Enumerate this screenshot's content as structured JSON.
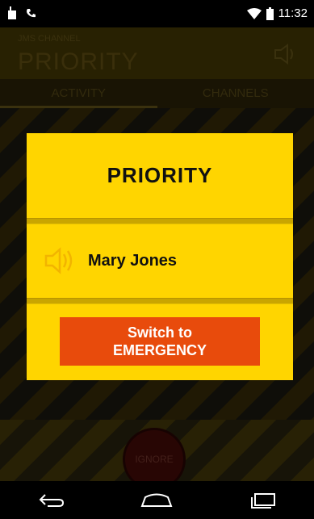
{
  "status_bar": {
    "time": "11:32",
    "icons": [
      "notification-icon",
      "voicemail-icon",
      "wifi-icon",
      "battery-icon"
    ]
  },
  "app": {
    "subtitle": "JMS CHANNEL",
    "title": "PRIORITY",
    "tabs": [
      {
        "label": "ACTIVITY"
      },
      {
        "label": "CHANNELS"
      }
    ],
    "ignore_label": "IGNORE"
  },
  "dialog": {
    "title": "PRIORITY",
    "caller_name": "Mary Jones",
    "switch_line1": "Switch to",
    "switch_line2": "EMERGENCY"
  },
  "colors": {
    "dialog_bg": "#ffd500",
    "switch_button": "#e84b0c",
    "speaker_icon": "#f2b400"
  },
  "nav_bar": {
    "icons": [
      "back-icon",
      "home-icon",
      "recents-icon"
    ]
  }
}
